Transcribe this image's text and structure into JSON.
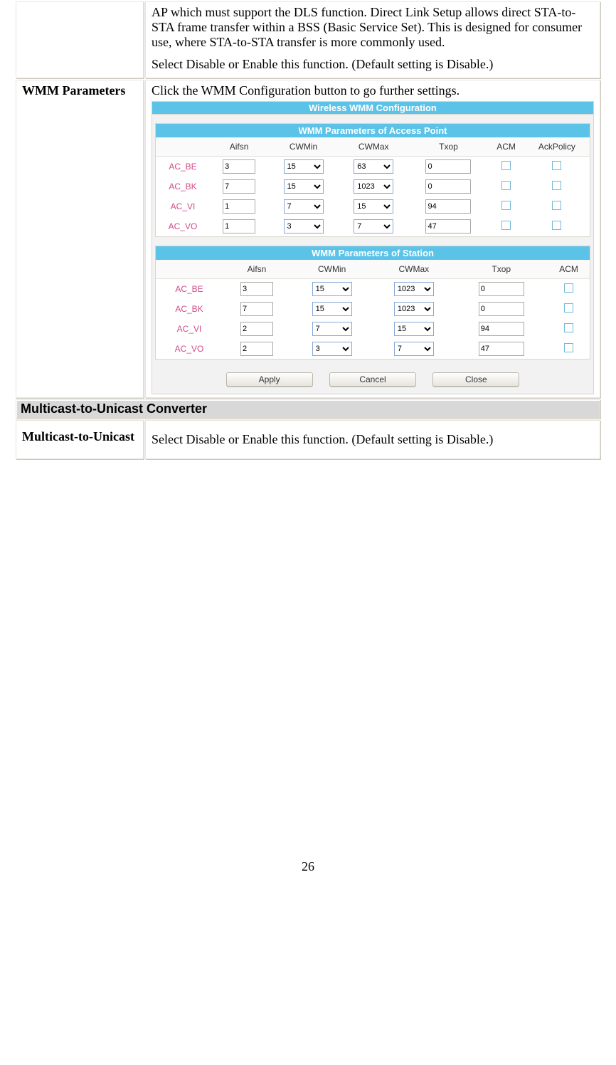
{
  "page_number": "26",
  "dls": {
    "desc1": "AP which must support the DLS function. Direct Link Setup allows direct STA-to-STA frame transfer within a BSS (Basic Service Set). This is designed for consumer use, where STA-to-STA transfer is more commonly used.",
    "desc2": "Select Disable or Enable this function. (Default setting is Disable.)"
  },
  "wmm": {
    "label": "WMM Parameters",
    "intro": "Click the WMM Configuration button to go further settings.",
    "panel_title": "Wireless WMM Configuration",
    "ap": {
      "title": "WMM Parameters of Access Point",
      "headers": [
        "",
        "Aifsn",
        "CWMin",
        "CWMax",
        "Txop",
        "ACM",
        "AckPolicy"
      ],
      "rows": [
        {
          "ac": "AC_BE",
          "aifsn": "3",
          "cwmin": "15",
          "cwmax": "63",
          "txop": "0",
          "acm": false,
          "ack": false
        },
        {
          "ac": "AC_BK",
          "aifsn": "7",
          "cwmin": "15",
          "cwmax": "1023",
          "txop": "0",
          "acm": false,
          "ack": false
        },
        {
          "ac": "AC_VI",
          "aifsn": "1",
          "cwmin": "7",
          "cwmax": "15",
          "txop": "94",
          "acm": false,
          "ack": false
        },
        {
          "ac": "AC_VO",
          "aifsn": "1",
          "cwmin": "3",
          "cwmax": "7",
          "txop": "47",
          "acm": false,
          "ack": false
        }
      ]
    },
    "sta": {
      "title": "WMM Parameters of Station",
      "headers": [
        "",
        "Aifsn",
        "CWMin",
        "CWMax",
        "Txop",
        "ACM"
      ],
      "rows": [
        {
          "ac": "AC_BE",
          "aifsn": "3",
          "cwmin": "15",
          "cwmax": "1023",
          "txop": "0",
          "acm": false
        },
        {
          "ac": "AC_BK",
          "aifsn": "7",
          "cwmin": "15",
          "cwmax": "1023",
          "txop": "0",
          "acm": false
        },
        {
          "ac": "AC_VI",
          "aifsn": "2",
          "cwmin": "7",
          "cwmax": "15",
          "txop": "94",
          "acm": false
        },
        {
          "ac": "AC_VO",
          "aifsn": "2",
          "cwmin": "3",
          "cwmax": "7",
          "txop": "47",
          "acm": false
        }
      ]
    },
    "buttons": {
      "apply": "Apply",
      "cancel": "Cancel",
      "close": "Close"
    }
  },
  "section_mc": "Multicast-to-Unicast Converter",
  "mc": {
    "label": "Multicast-to-Unicast",
    "desc": "Select Disable or Enable this function. (Default setting is Disable.)"
  }
}
